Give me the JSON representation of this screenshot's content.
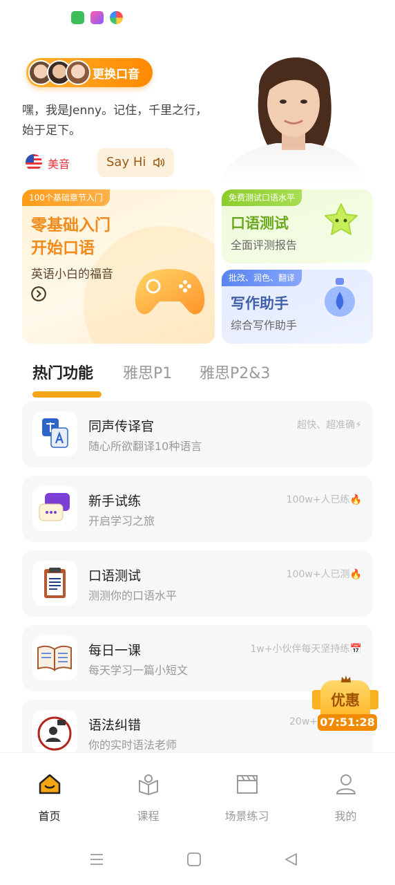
{
  "header": {
    "voice_button": "更换口音",
    "intro": "嘿，我是Jenny。记住，千里之行，始于足下。",
    "accent": "美音",
    "say_hi": "Say Hi"
  },
  "cards": {
    "main": {
      "tag": "100个基础章节入门",
      "title_line1": "零基础入门",
      "title_line2": "开始口语",
      "subtitle": "英语小白的福音"
    },
    "speaking": {
      "tag": "免费测试口语水平",
      "title": "口语测试",
      "subtitle": "全面评测报告"
    },
    "writing": {
      "tag": "批改、润色、翻译",
      "title": "写作助手",
      "subtitle": "综合写作助手"
    }
  },
  "tabs": [
    "热门功能",
    "雅思P1",
    "雅思P2&3"
  ],
  "list": [
    {
      "title": "同声传译官",
      "subtitle": "随心所欲翻译10种语言",
      "meta": "超快、超准确⚡"
    },
    {
      "title": "新手试练",
      "subtitle": "开启学习之旅",
      "meta": "100w+人已练🔥"
    },
    {
      "title": "口语测试",
      "subtitle": "测测你的口语水平",
      "meta": "100w+人已测🔥"
    },
    {
      "title": "每日一课",
      "subtitle": "每天学习一篇小短文",
      "meta": "1w+小伙伴每天坚持练📅"
    },
    {
      "title": "语法纠错",
      "subtitle": "你的实时语法老师",
      "meta": "20w+"
    }
  ],
  "promo": {
    "label": "优惠",
    "timer": "07:51:28"
  },
  "nav": [
    "首页",
    "课程",
    "场景练习",
    "我的"
  ],
  "colors": {
    "accent": "#f5a516",
    "orange_text": "#f08a1a",
    "green_text": "#6aa81c",
    "blue_text": "#3f5fa8"
  }
}
